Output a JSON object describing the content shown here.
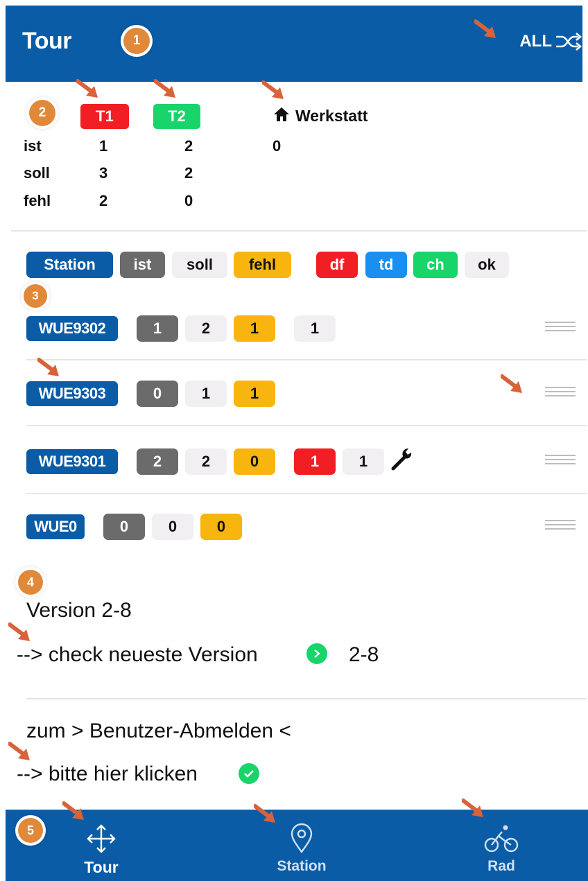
{
  "header": {
    "title": "Tour",
    "all_label": "ALL",
    "marker": "1"
  },
  "summary": {
    "marker": "2",
    "tags": {
      "t1": "T1",
      "t2": "T2",
      "workshop": "Werkstatt"
    },
    "rows": [
      {
        "label": "ist",
        "t1": "1",
        "t2": "2",
        "workshop": "0"
      },
      {
        "label": "soll",
        "t1": "3",
        "t2": "2",
        "workshop": ""
      },
      {
        "label": "fehl",
        "t1": "2",
        "t2": "0",
        "workshop": ""
      }
    ],
    "colors": {
      "t1": "#f11f23",
      "t2": "#19d46a"
    }
  },
  "legend": {
    "station": "Station",
    "ist": "ist",
    "soll": "soll",
    "fehl": "fehl",
    "df": "df",
    "td": "td",
    "ch": "ch",
    "ok": "ok",
    "marker": "3"
  },
  "stations": [
    {
      "id": "WUE9302",
      "ist": "1",
      "soll": "2",
      "fehl": "1",
      "ok": "1"
    },
    {
      "id": "WUE9303",
      "ist": "0",
      "soll": "1",
      "fehl": "1"
    },
    {
      "id": "WUE9301",
      "ist": "2",
      "soll": "2",
      "fehl": "0",
      "df": "1",
      "ok": "1",
      "icon": "wrench-icon"
    },
    {
      "id": "WUE0",
      "ist": "0",
      "soll": "0",
      "fehl": "0"
    }
  ],
  "version": {
    "marker": "4",
    "label": "Version 2-8",
    "check_text": "--> check neueste Version",
    "latest": "2-8"
  },
  "logout": {
    "label": "zum > Benutzer-Abmelden <",
    "link_text": "--> bitte hier klicken"
  },
  "bottom_nav": {
    "marker": "5",
    "items": [
      {
        "label": "Tour",
        "icon": "move-icon",
        "active": true
      },
      {
        "label": "Station",
        "icon": "map-pin-icon",
        "active": false
      },
      {
        "label": "Rad",
        "icon": "bicycle-icon",
        "active": false
      }
    ]
  },
  "accent_colors": {
    "brand_blue": "#0a5ca6",
    "marker_orange": "#e0893a",
    "arrow": "#d9623a"
  }
}
